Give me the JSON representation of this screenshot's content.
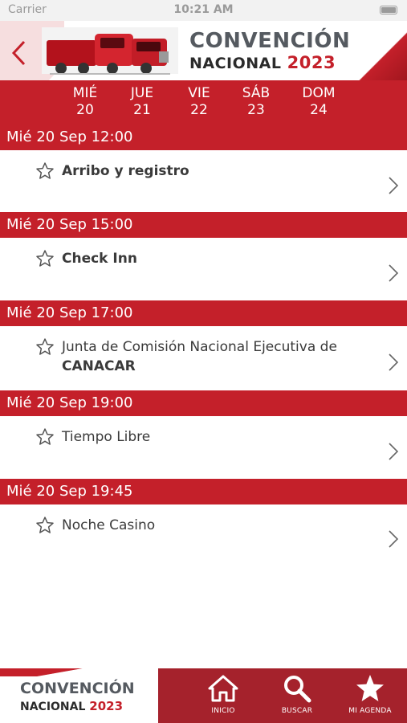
{
  "status_bar": {
    "carrier": "Carrier",
    "time": "10:21 AM"
  },
  "header": {
    "logo_line1": "CONVENCIÓN",
    "logo_line2": "NACIONAL",
    "logo_year": "2023"
  },
  "days": [
    {
      "name": "MIÉ",
      "num": "20"
    },
    {
      "name": "JUE",
      "num": "21"
    },
    {
      "name": "VIE",
      "num": "22"
    },
    {
      "name": "SÁB",
      "num": "23"
    },
    {
      "name": "DOM",
      "num": "24"
    }
  ],
  "agenda": [
    {
      "time": "Mié 20 Sep 12:00",
      "title": "Arribo y registro"
    },
    {
      "time": "Mié 20 Sep 15:00",
      "title": "Check Inn"
    },
    {
      "time": "Mié 20 Sep 17:00",
      "title_line1": "Junta de Comisión Nacional Ejecutiva de",
      "title_line2": "CANACAR"
    },
    {
      "time": "Mié 20 Sep 19:00",
      "title": "Tiempo Libre"
    },
    {
      "time": "Mié 20 Sep 19:45",
      "title": "Noche Casino"
    }
  ],
  "bottom_logo": {
    "line1": "CONVENCIÓN",
    "line2": "NACIONAL",
    "year": "2023"
  },
  "tabbar": {
    "items": [
      {
        "label": "INICIO",
        "icon": "home-icon"
      },
      {
        "label": "BUSCAR",
        "icon": "search-icon"
      },
      {
        "label": "MI AGENDA",
        "icon": "star-icon"
      }
    ]
  },
  "colors": {
    "brand_red": "#c4202a",
    "tabbar_red": "#a5222c"
  }
}
